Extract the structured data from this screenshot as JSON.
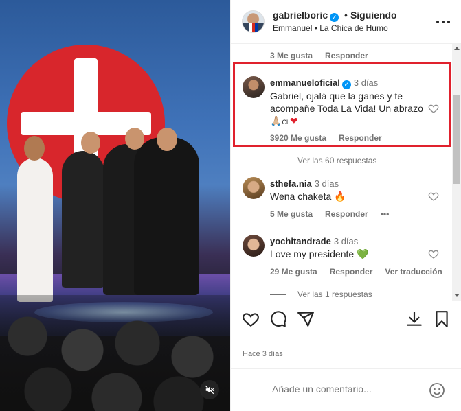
{
  "header": {
    "username": "gabrielboric",
    "follow_status": "Siguiendo",
    "subtitle": "Emmanuel • La Chica de Humo"
  },
  "comments": {
    "prev_meta": {
      "likes": "3 Me gusta",
      "reply": "Responder"
    },
    "items": [
      {
        "username": "emmanueloficial",
        "time": "3 días",
        "text_line1": "Gabriel, ojalá que la ganes y te",
        "text_line2": "acompañe Toda La Vida! Un abrazo",
        "text_line3": "🙏🏼",
        "text_flag": "CL",
        "text_heart": "❤",
        "likes": "3920 Me gusta",
        "reply": "Responder",
        "view_replies": "Ver las 60 respuestas",
        "highlighted": true
      },
      {
        "username": "sthefa.nia",
        "time": "3 días",
        "text": "Wena chaketa 🔥",
        "likes": "5 Me gusta",
        "reply": "Responder",
        "more": "•••"
      },
      {
        "username": "yochitandrade",
        "time": "3 días",
        "text": "Love my presidente 💚",
        "likes": "29 Me gusta",
        "reply": "Responder",
        "translate": "Ver traducción",
        "view_replies": "Ver las 1 respuestas"
      }
    ]
  },
  "footer": {
    "time_ago": "Hace 3 días",
    "comment_placeholder": "Añade un comentario..."
  },
  "colors": {
    "highlight": "#e0212d",
    "verified": "#0095f6",
    "muted_text": "#737373"
  },
  "icons": [
    "verified-icon",
    "more-options-icon",
    "heart-icon",
    "comment-icon",
    "share-icon",
    "download-icon",
    "bookmark-icon",
    "emoji-icon",
    "mute-icon"
  ]
}
